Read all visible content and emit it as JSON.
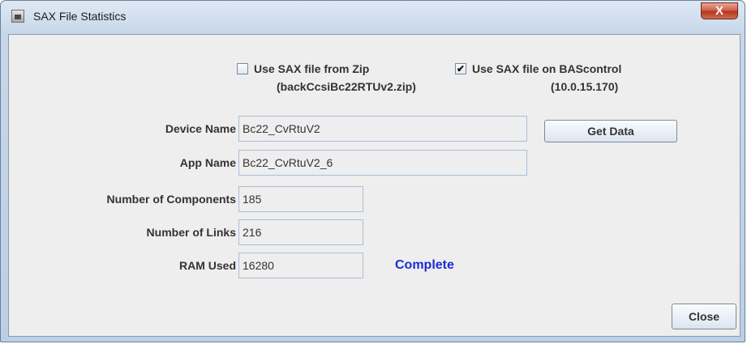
{
  "window": {
    "title": "SAX File Statistics",
    "close_glyph": "X"
  },
  "options": {
    "zip": {
      "label": "Use SAX file from Zip",
      "sub": "(backCcsiBc22RTUv2.zip)",
      "checked": false,
      "mark": ""
    },
    "bascontrol": {
      "label": "Use SAX file on BAScontrol",
      "sub": "(10.0.15.170)",
      "checked": true,
      "mark": "✔"
    }
  },
  "fields": {
    "device_name": {
      "label": "Device Name",
      "value": "Bc22_CvRtuV2"
    },
    "app_name": {
      "label": "App Name",
      "value": "Bc22_CvRtuV2_6"
    },
    "components": {
      "label": "Number of Components",
      "value": "185"
    },
    "links": {
      "label": "Number of Links",
      "value": "216"
    },
    "ram": {
      "label": "RAM Used",
      "value": "16280"
    }
  },
  "status": {
    "text": "Complete",
    "color": "#1c2bd6"
  },
  "buttons": {
    "get_data": "Get Data",
    "close": "Close"
  },
  "icons": {
    "app": "java-app-icon",
    "close": "close-icon"
  }
}
